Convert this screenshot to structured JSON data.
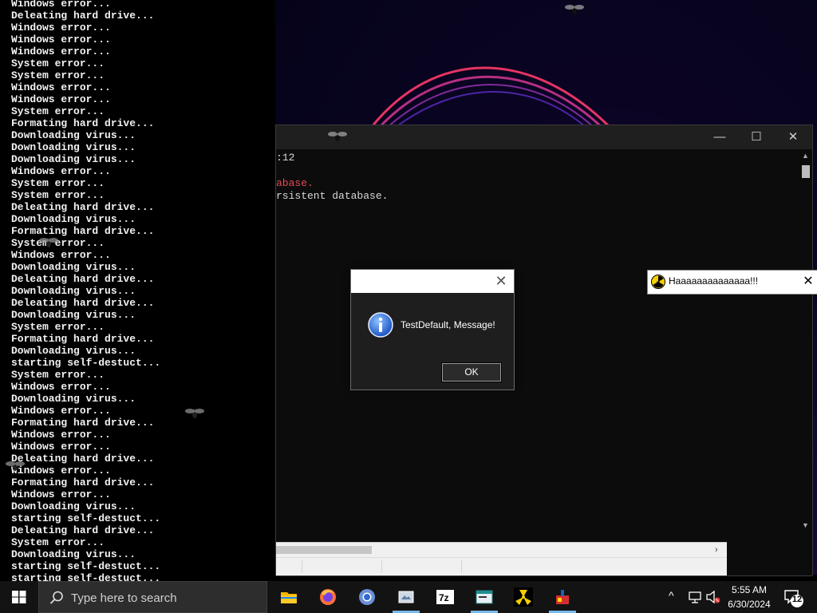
{
  "console": {
    "lines": [
      "Windows error...",
      "Deleating hard drive...",
      "Windows error...",
      "Windows error...",
      "Windows error...",
      "System error...",
      "System error...",
      "Windows error...",
      "Windows error...",
      "System error...",
      "Formating hard drive...",
      "Downloading virus...",
      "Downloading virus...",
      "Downloading virus...",
      "Windows error...",
      "System error...",
      "System error...",
      "Deleating hard drive...",
      "Downloading virus...",
      "Formating hard drive...",
      "System error...",
      "Windows error...",
      "Downloading virus...",
      "Deleating hard drive...",
      "Downloading virus...",
      "Deleating hard drive...",
      "Downloading virus...",
      "System error...",
      "Formating hard drive...",
      "Downloading virus...",
      "starting self-destuct...",
      "System error...",
      "Windows error...",
      "Downloading virus...",
      "Windows error...",
      "Formating hard drive...",
      "Windows error...",
      "Windows error...",
      "Deleating hard drive...",
      "Windows error...",
      "Formating hard drive...",
      "Windows error...",
      "Downloading virus...",
      "starting self-destuct...",
      "Deleating hard drive...",
      "System error...",
      "Downloading virus...",
      "starting self-destuct...",
      "starting self-destuct..."
    ]
  },
  "terminal": {
    "line1": ":12",
    "line2": "abase.",
    "line3": "rsistent database.",
    "minimize": "—",
    "maximize": "☐",
    "close": "✕"
  },
  "msgbox": {
    "text": "TestDefault, Message!",
    "ok_label": "OK",
    "close": "✕",
    "icon": "info-icon"
  },
  "notification": {
    "text": "Haaaaaaaaaaaaaa!!!",
    "close": "✕",
    "icon": "radiation-icon"
  },
  "taskbar": {
    "search_placeholder": "Type here to search",
    "apps": [
      "file-explorer-icon",
      "firefox-icon",
      "chromium-icon",
      "app-icon",
      "7zip-icon",
      "app-window-icon",
      "radiation-icon",
      "app-colorful-icon"
    ],
    "time": "5:55 AM",
    "date": "6/30/2024",
    "notification_count": "12"
  },
  "colors": {
    "accent": "#76b9ed",
    "error_red": "#e74856"
  }
}
